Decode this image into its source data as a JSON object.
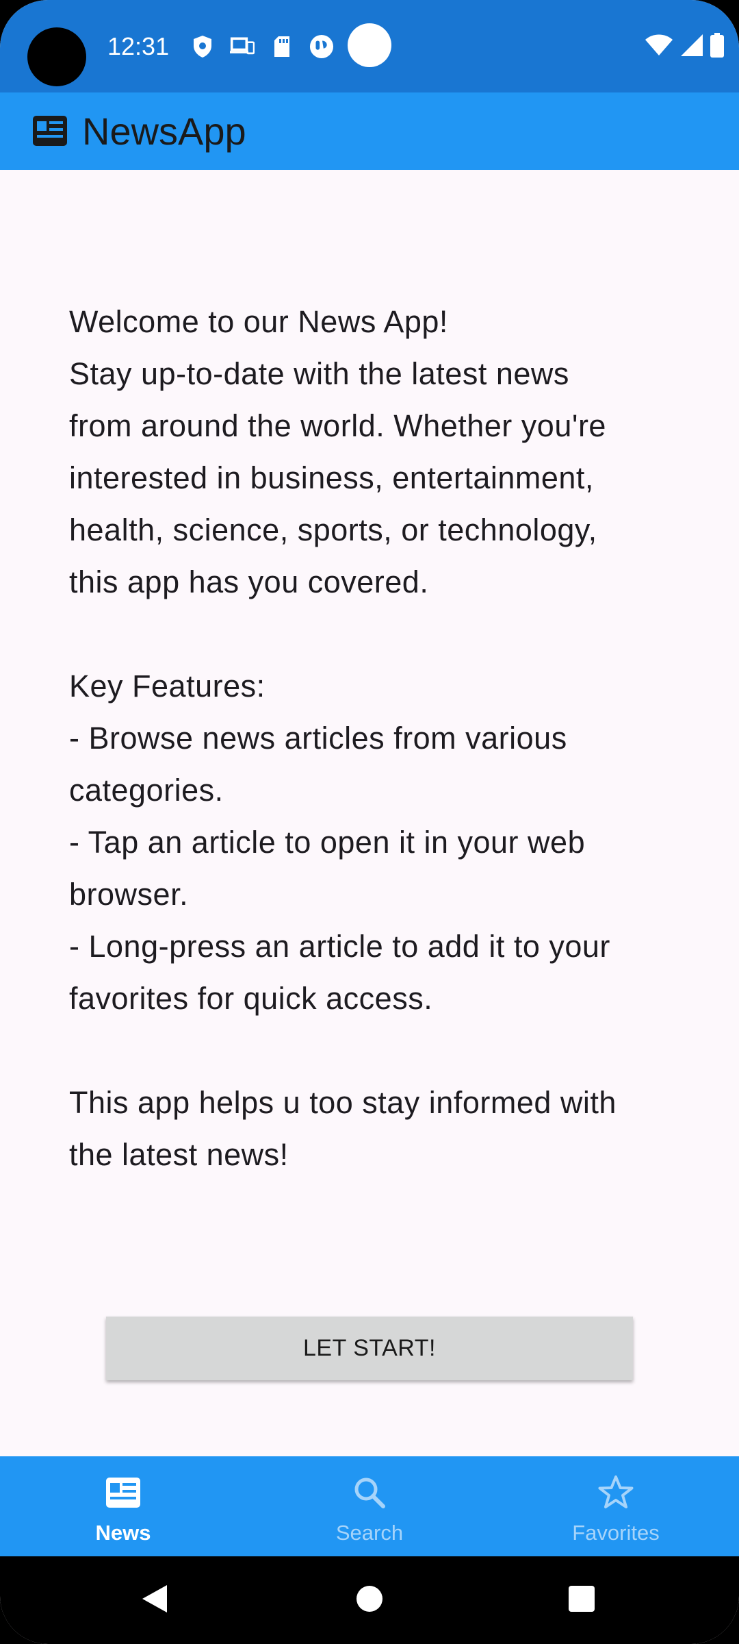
{
  "status_bar": {
    "time": "12:31"
  },
  "app_bar": {
    "title": "NewsApp",
    "icon": "newspaper-icon"
  },
  "content": {
    "welcome_line": "Welcome to our News App!",
    "intro_lines": [
      "Stay up-to-date with the latest news",
      "from around the world. Whether you're",
      "interested in business, entertainment,",
      "health, science, sports, or technology,",
      "this app has you covered."
    ],
    "features_heading": "Key Features:",
    "feature_lines": [
      "- Browse news articles from various",
      "categories.",
      "- Tap an article to open it in your web",
      "browser.",
      "- Long-press an article to add it to your",
      "favorites for quick access."
    ],
    "closing_lines": [
      "This app helps u too stay informed with",
      "the latest news!"
    ]
  },
  "start_button": {
    "label": "LET START!"
  },
  "bottom_nav": {
    "items": [
      {
        "label": "News",
        "icon": "newspaper-icon",
        "active": true
      },
      {
        "label": "Search",
        "icon": "search-icon",
        "active": false
      },
      {
        "label": "Favorites",
        "icon": "star-icon",
        "active": false
      }
    ]
  },
  "colors": {
    "status_bar": "#1976d2",
    "app_bar": "#2196f3",
    "background": "#fdf8fc",
    "button": "#d6d7d7",
    "nav_inactive": "#a6d4fa"
  }
}
